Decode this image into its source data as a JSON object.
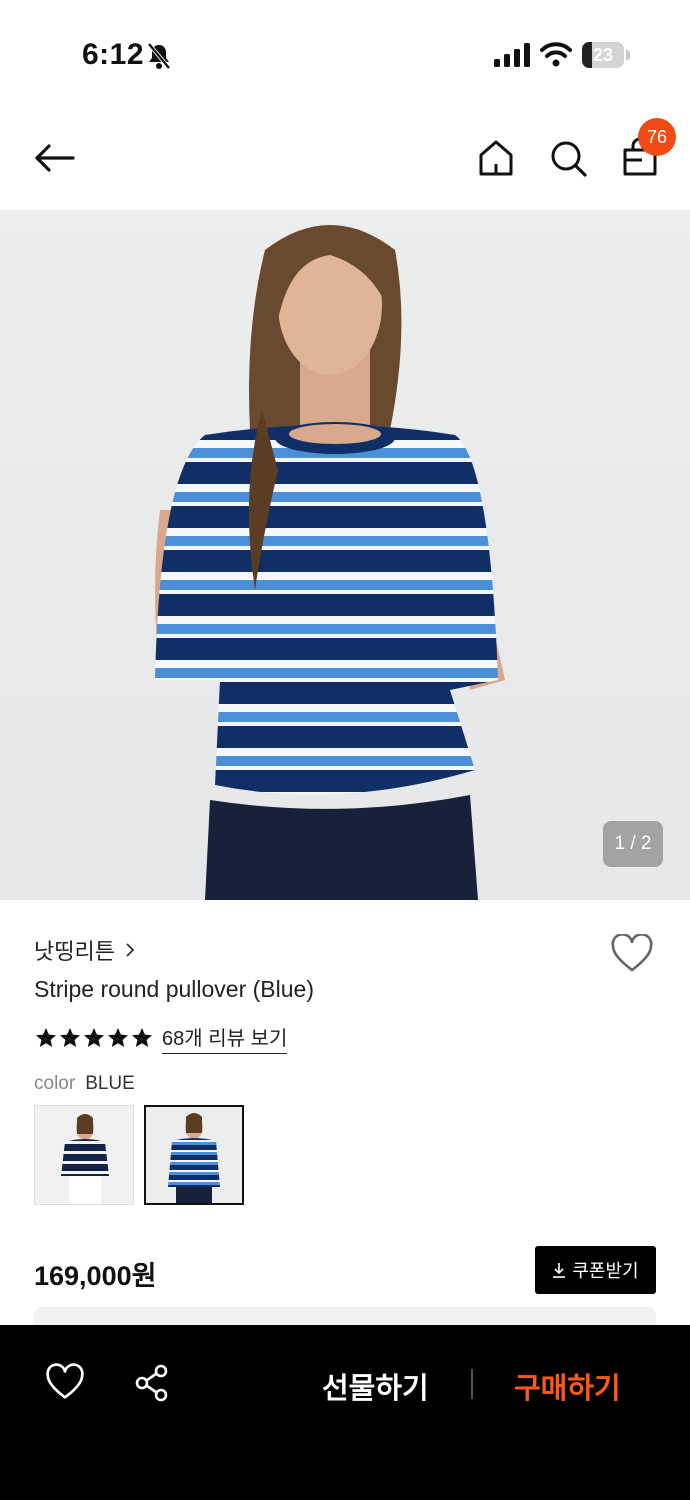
{
  "status_bar": {
    "time": "6:12",
    "battery": "23",
    "battery_level": 0.23
  },
  "header": {
    "cart_count": "76"
  },
  "gallery": {
    "counter": "1 / 2"
  },
  "product": {
    "brand": "낫띵리튼",
    "name": "Stripe round pullover (Blue)",
    "rating_stars": 5,
    "review_link": "68개 리뷰 보기",
    "color_label": "color",
    "color_value": "BLUE",
    "price": "169,000원",
    "coupon_label": "쿠폰받기"
  },
  "bottom_bar": {
    "gift_label": "선물하기",
    "buy_label": "구매하기"
  },
  "colors": {
    "accent": "#f24a13",
    "buy": "#ff5a14",
    "bar": "#000000"
  }
}
